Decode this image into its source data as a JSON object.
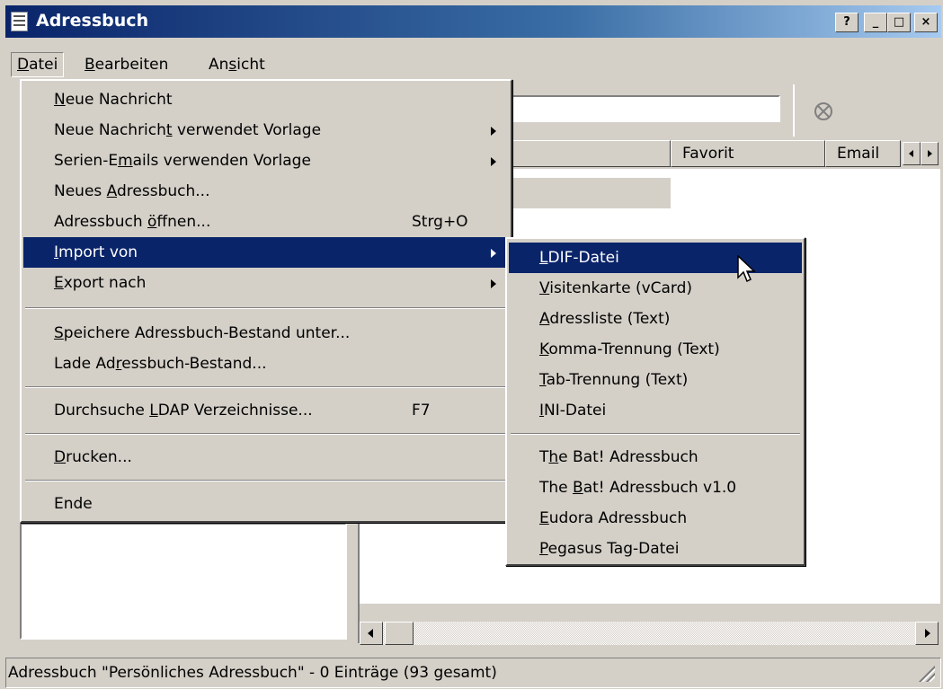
{
  "window": {
    "title": "Adressbuch",
    "controls": [
      "?",
      "_",
      "□",
      "×"
    ]
  },
  "menubar": {
    "file": {
      "prefix": "",
      "accel": "D",
      "rest": "atei"
    },
    "edit": {
      "prefix": "",
      "accel": "B",
      "rest": "earbeiten"
    },
    "view": {
      "prefix": "An",
      "accel": "s",
      "rest": "icht"
    }
  },
  "columns": {
    "favorite": "Favorit",
    "email": "Email"
  },
  "file_menu": {
    "new_message": {
      "prefix": "",
      "accel": "N",
      "rest": "eue Nachricht"
    },
    "new_message_template": {
      "prefix": "Neue Nachrich",
      "accel": "t",
      "rest": " verwendet Vorlage"
    },
    "serial_emails": {
      "prefix": "Serien-E",
      "accel": "m",
      "rest": "ails verwenden Vorlage"
    },
    "new_addressbook": {
      "prefix": "Neues ",
      "accel": "A",
      "rest": "dressbuch..."
    },
    "open_addressbook": {
      "prefix": "Adressbuch ",
      "accel": "ö",
      "rest": "ffnen...",
      "shortcut": "Strg+O"
    },
    "import_from": {
      "prefix": "",
      "accel": "I",
      "rest": "mport von"
    },
    "export_to": {
      "prefix": "",
      "accel": "E",
      "rest": "xport nach"
    },
    "save_stock": {
      "prefix": "",
      "accel": "S",
      "rest": "peichere Adressbuch-Bestand unter..."
    },
    "load_stock": {
      "prefix": "Lade Ad",
      "accel": "r",
      "rest": "essbuch-Bestand..."
    },
    "search_ldap": {
      "prefix": "Durchsuche ",
      "accel": "L",
      "rest": "DAP Verzeichnisse...",
      "shortcut": "F7"
    },
    "print": {
      "prefix": "",
      "accel": "D",
      "rest": "rucken..."
    },
    "exit": {
      "prefix": "",
      "accel": "",
      "rest": "Ende"
    }
  },
  "import_menu": {
    "ldif": {
      "prefix": "",
      "accel": "L",
      "rest": "DIF-Datei"
    },
    "vcard": {
      "prefix": "",
      "accel": "V",
      "rest": "isitenkarte (vCard)"
    },
    "address_list": {
      "prefix": "",
      "accel": "A",
      "rest": "dressliste (Text)"
    },
    "comma": {
      "prefix": "",
      "accel": "K",
      "rest": "omma-Trennung (Text)"
    },
    "tab": {
      "prefix": "",
      "accel": "T",
      "rest": "ab-Trennung (Text)"
    },
    "ini": {
      "prefix": "",
      "accel": "I",
      "rest": "NI-Datei"
    },
    "thebat": {
      "prefix": "T",
      "accel": "h",
      "rest": "e Bat! Adressbuch"
    },
    "thebat_v1": {
      "prefix": "The ",
      "accel": "B",
      "rest": "at! Adressbuch v1.0"
    },
    "eudora": {
      "prefix": "",
      "accel": "E",
      "rest": "udora Adressbuch"
    },
    "pegasus": {
      "prefix": "",
      "accel": "P",
      "rest": "egasus Tag-Datei"
    }
  },
  "statusbar": {
    "text": "Adressbuch \"Persönliches Adressbuch\" - 0 Einträge (93 gesamt)"
  },
  "colors": {
    "highlight": "#0a246a",
    "face": "#d4d0c8"
  }
}
